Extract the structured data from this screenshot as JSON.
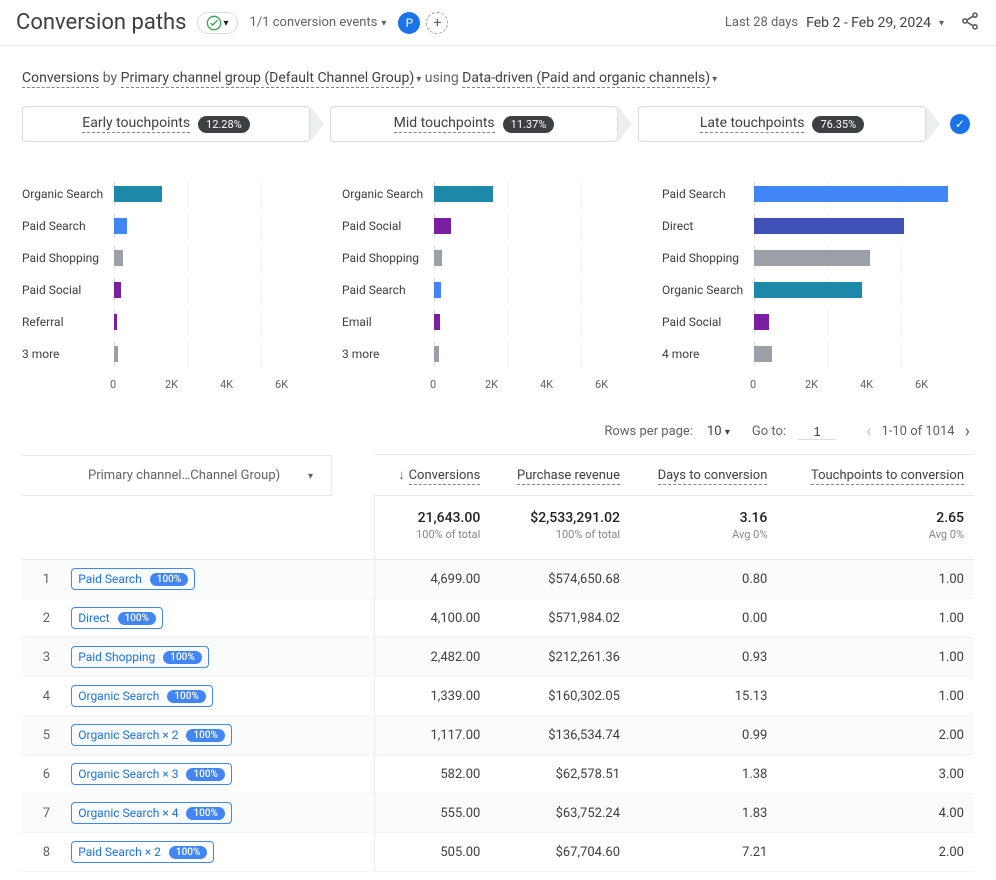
{
  "header": {
    "title": "Conversion paths",
    "events_label": "1/1 conversion events",
    "avatar_letter": "P",
    "date_prefix": "Last 28 days",
    "date_range": "Feb 2 - Feb 29, 2024"
  },
  "sentence": {
    "left": "Conversions",
    "mid1": " by ",
    "dim": "Primary channel group (Default Channel Group)",
    "mid2": " using ",
    "model": "Data-driven (Paid and organic channels)"
  },
  "tabs": [
    {
      "label": "Early touchpoints",
      "pct": "12.28%"
    },
    {
      "label": "Mid touchpoints",
      "pct": "11.37%"
    },
    {
      "label": "Late touchpoints",
      "pct": "76.35%"
    }
  ],
  "chart_data": [
    {
      "type": "bar",
      "orientation": "horizontal",
      "ticks": [
        "0",
        "2K",
        "4K",
        "6K"
      ],
      "xmax": 6000,
      "categories": [
        "Organic Search",
        "Paid Search",
        "Paid Shopping",
        "Paid Social",
        "Referral",
        "3 more"
      ],
      "values": [
        1300,
        350,
        250,
        200,
        70,
        120
      ],
      "colors": [
        "#1e88a8",
        "#4285f4",
        "#9aa0a6",
        "#7b1fa2",
        "#7b1fa2",
        "#9aa0a6"
      ]
    },
    {
      "type": "bar",
      "orientation": "horizontal",
      "ticks": [
        "0",
        "2K",
        "4K",
        "6K"
      ],
      "xmax": 6000,
      "categories": [
        "Organic Search",
        "Paid Social",
        "Paid Shopping",
        "Paid Search",
        "Email",
        "3 more"
      ],
      "values": [
        1600,
        450,
        230,
        180,
        170,
        130
      ],
      "colors": [
        "#1e88a8",
        "#7b1fa2",
        "#9aa0a6",
        "#4285f4",
        "#7b1fa2",
        "#9aa0a6"
      ]
    },
    {
      "type": "bar",
      "orientation": "horizontal",
      "ticks": [
        "0",
        "2K",
        "4K",
        "6K"
      ],
      "xmax": 6000,
      "categories": [
        "Paid Search",
        "Direct",
        "Paid Shopping",
        "Organic Search",
        "Paid Social",
        "4 more"
      ],
      "values": [
        5300,
        4100,
        3150,
        2950,
        420,
        500
      ],
      "colors": [
        "#4285f4",
        "#3f51b5",
        "#9aa0a6",
        "#1e88a8",
        "#7b1fa2",
        "#9aa0a6"
      ]
    }
  ],
  "controls": {
    "rows_label": "Rows per page:",
    "rows_value": "10",
    "goto_label": "Go to:",
    "goto_value": "1",
    "range_text": "1-10 of 1014"
  },
  "table": {
    "dim_header": "Primary channel…Channel Group)",
    "cols": [
      "Conversions",
      "Purchase revenue",
      "Days to conversion",
      "Touchpoints to conversion"
    ],
    "summary": {
      "conversions": "21,643.00",
      "conversions_sub": "100% of total",
      "revenue": "$2,533,291.02",
      "revenue_sub": "100% of total",
      "days": "3.16",
      "days_sub": "Avg 0%",
      "touch": "2.65",
      "touch_sub": "Avg 0%"
    },
    "rows": [
      {
        "idx": "1",
        "path": "Paid Search",
        "badge": "100%",
        "c": "4,699.00",
        "r": "$574,650.68",
        "d": "0.80",
        "t": "1.00"
      },
      {
        "idx": "2",
        "path": "Direct",
        "badge": "100%",
        "c": "4,100.00",
        "r": "$571,984.02",
        "d": "0.00",
        "t": "1.00"
      },
      {
        "idx": "3",
        "path": "Paid Shopping",
        "badge": "100%",
        "c": "2,482.00",
        "r": "$212,261.36",
        "d": "0.93",
        "t": "1.00"
      },
      {
        "idx": "4",
        "path": "Organic Search",
        "badge": "100%",
        "c": "1,339.00",
        "r": "$160,302.05",
        "d": "15.13",
        "t": "1.00"
      },
      {
        "idx": "5",
        "path": "Organic Search × 2",
        "badge": "100%",
        "c": "1,117.00",
        "r": "$136,534.74",
        "d": "0.99",
        "t": "2.00"
      },
      {
        "idx": "6",
        "path": "Organic Search × 3",
        "badge": "100%",
        "c": "582.00",
        "r": "$62,578.51",
        "d": "1.38",
        "t": "3.00"
      },
      {
        "idx": "7",
        "path": "Organic Search × 4",
        "badge": "100%",
        "c": "555.00",
        "r": "$63,752.24",
        "d": "1.83",
        "t": "4.00"
      },
      {
        "idx": "8",
        "path": "Paid Search × 2",
        "badge": "100%",
        "c": "505.00",
        "r": "$67,704.60",
        "d": "7.21",
        "t": "2.00"
      }
    ]
  }
}
